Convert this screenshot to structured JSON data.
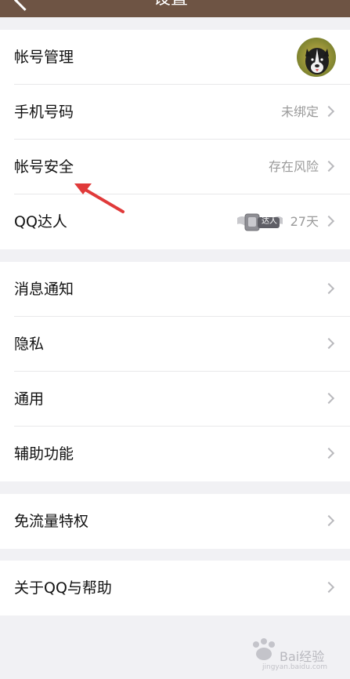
{
  "header": {
    "title_fragment": "设置"
  },
  "account_group": {
    "items": [
      {
        "label": "帐号管理"
      },
      {
        "label": "手机号码",
        "value": "未绑定"
      },
      {
        "label": "帐号安全",
        "value": "存在风险"
      },
      {
        "label": "QQ达人",
        "badge_text": "达人",
        "value": "27天"
      }
    ]
  },
  "settings_group": {
    "items": [
      {
        "label": "消息通知"
      },
      {
        "label": "隐私"
      },
      {
        "label": "通用"
      },
      {
        "label": "辅助功能"
      }
    ]
  },
  "data_group": {
    "items": [
      {
        "label": "免流量特权"
      }
    ]
  },
  "about_group": {
    "items": [
      {
        "label": "关于QQ与帮助"
      }
    ]
  },
  "watermark": {
    "brand": "Bai经验",
    "url": "jingyan.baidu.com"
  },
  "colors": {
    "header_bg": "#6e5444",
    "page_bg": "#f1f1f4",
    "annotation_arrow": "#e03a3a"
  }
}
